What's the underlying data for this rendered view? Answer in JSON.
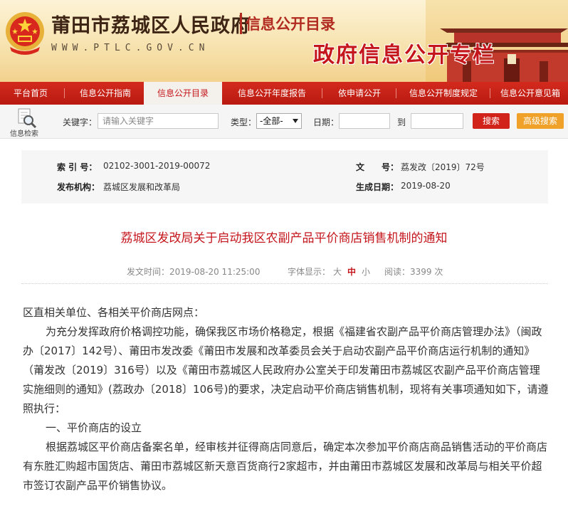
{
  "header": {
    "site_title": "莆田市荔城区人民政府",
    "catalog_title": "信息公开目录",
    "site_url": "WWW.PTLC.GOV.CN",
    "slogan": "政府信息公开专栏",
    "accent_color": "#c4161c"
  },
  "nav": {
    "items": [
      {
        "label": "平台首页"
      },
      {
        "label": "信息公开指南"
      },
      {
        "label": "信息公开目录",
        "active": true
      },
      {
        "label": "信息公开年度报告"
      },
      {
        "label": "依申请公开"
      },
      {
        "label": "信息公开制度规定"
      },
      {
        "label": "信息公开意见箱"
      }
    ]
  },
  "search": {
    "icon_label": "信息检索",
    "keyword_label": "关键字：",
    "keyword_placeholder": "请输入关键字",
    "type_label": "类型：",
    "type_selected": "-全部-",
    "date_label": "日期：",
    "to_label": "到",
    "search_button": "搜索",
    "advanced_button": "高级搜索"
  },
  "meta": {
    "index_label": "索 引 号：",
    "index_value": "02102-3001-2019-00072",
    "doc_label": "文　　号：",
    "doc_value": "荔发改〔2019〕72号",
    "org_label": "发布机构：",
    "org_value": "荔城区发展和改革局",
    "date_label": "生成日期：",
    "date_value": "2019-08-20"
  },
  "article": {
    "title": "荔城区发改局关于启动我区农副产品平价商店销售机制的通知",
    "publish_time": "发文时间：2019-08-20 11:25:00",
    "font_label": "字体显示：",
    "font_large": "大",
    "font_medium": "中",
    "font_small": "小",
    "views": "阅读：3399 次",
    "salutation": "区直相关单位、各相关平价商店网点：",
    "para1": "为充分发挥政府价格调控功能，确保我区市场价格稳定，根据《福建省农副产品平价商店管理办法》（闽政办〔2017〕142号）、莆田市发改委《莆田市发展和改革委员会关于启动农副产品平价商店运行机制的通知》（莆发改〔2019〕316号）以及《莆田市荔城区人民政府办公室关于印发莆田市荔城区农副产品平价商店管理实施细则的通知》(荔政办〔2018〕106号)的要求，决定启动平价商店销售机制，现将有关事项通知如下，请遵照执行：",
    "section1": "一、平价商店的设立",
    "para2": "根据荔城区平价商店备案名单，经审核并征得商店同意后，确定本次参加平价商店商品销售活动的平价商店有东胜汇购超市国货店、莆田市荔城区新天意百货商行2家超市，并由莆田市荔城区发展和改革局与相关平价超市签订农副产品平价销售协议。"
  }
}
